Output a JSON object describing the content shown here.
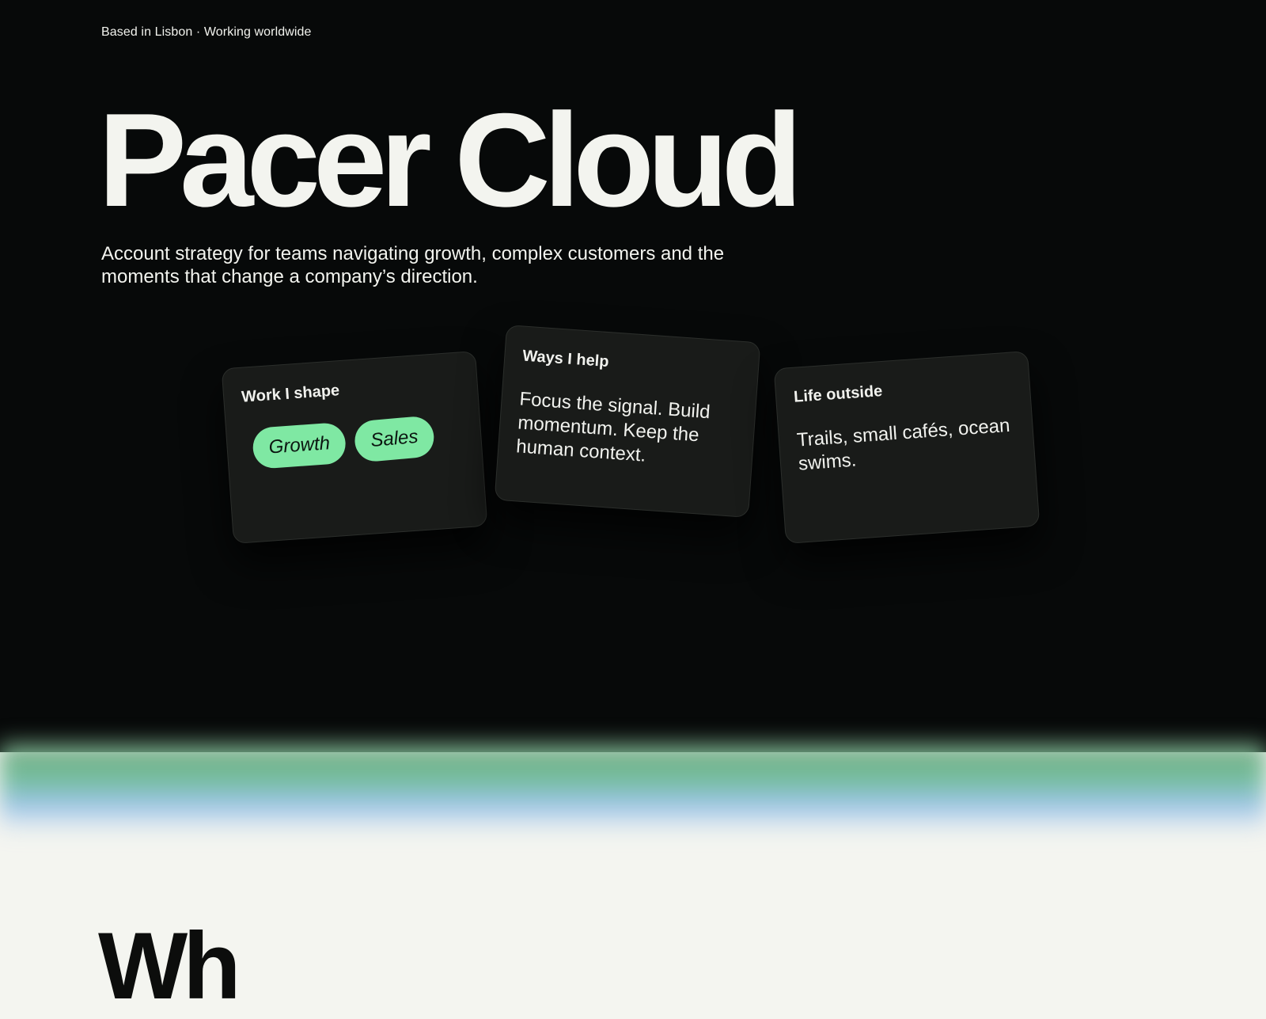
{
  "hero": {
    "location": "Based in Lisbon · Working worldwide",
    "title": "Pacer Cloud",
    "subtitle": "Account strategy for teams navigating growth, complex customers and the moments that change a company’s direction."
  },
  "cards": [
    {
      "title": "Work I shape",
      "tags": [
        "Growth",
        "Sales"
      ]
    },
    {
      "title": "Ways I help",
      "text": "Focus the signal. Build momentum. Keep the human context."
    },
    {
      "title": "Life outside",
      "text": "Trails, small cafés, ocean swims."
    }
  ],
  "next_section": {
    "heading": "Wh"
  },
  "colors": {
    "hero_background": "#070909",
    "card_background": "#191b19",
    "tag_background": "#7fe8a3",
    "page_background": "#f4f5f0"
  }
}
